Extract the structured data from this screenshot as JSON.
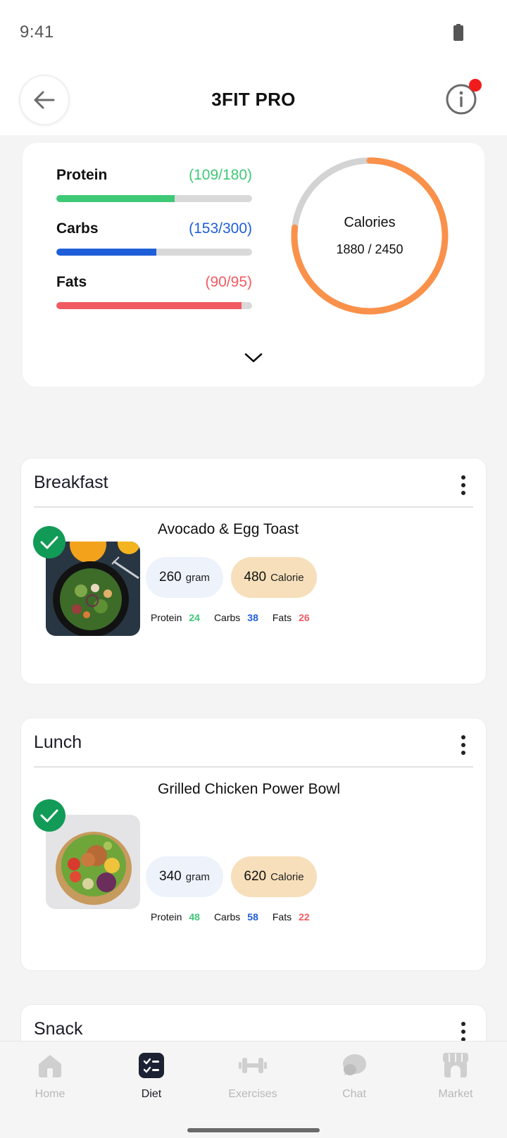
{
  "status_bar": {
    "time": "9:41"
  },
  "header": {
    "title": "3FIT PRO"
  },
  "summary": {
    "macros": [
      {
        "name": "Protein",
        "value": "(109/180)",
        "current": 109,
        "target": 180,
        "color": "#3ec977"
      },
      {
        "name": "Carbs",
        "value": "(153/300)",
        "current": 153,
        "target": 300,
        "color": "#1e5ed8"
      },
      {
        "name": "Fats",
        "value": "(90/95)",
        "current": 90,
        "target": 95,
        "color": "#f25a62"
      }
    ],
    "calories": {
      "label": "Calories",
      "value": "1880 / 2450",
      "current": 1880,
      "target": 2450,
      "color": "#fa914a",
      "track_color": "#d3d3d3"
    }
  },
  "meals": [
    {
      "title": "Breakfast",
      "food": {
        "name": "Avocado & Egg Toast",
        "grams": "260",
        "grams_unit": "gram",
        "calories": "480",
        "calories_unit": "Calorie",
        "protein_label": "Protein",
        "protein": "24",
        "carbs_label": "Carbs",
        "carbs": "38",
        "fats_label": "Fats",
        "fats": "26",
        "checked": true
      }
    },
    {
      "title": "Lunch",
      "food": {
        "name": "Grilled Chicken Power Bowl",
        "grams": "340",
        "grams_unit": "gram",
        "calories": "620",
        "calories_unit": "Calorie",
        "protein_label": "Protein",
        "protein": "48",
        "carbs_label": "Carbs",
        "carbs": "58",
        "fats_label": "Fats",
        "fats": "22",
        "checked": true
      }
    },
    {
      "title": "Snack"
    }
  ],
  "colors": {
    "protein": "#3ec977",
    "carbs": "#1e5ed8",
    "fats": "#f25a62",
    "check": "#129b56"
  },
  "nav": {
    "items": [
      {
        "label": "Home",
        "icon": "home-icon",
        "active": false
      },
      {
        "label": "Diet",
        "icon": "diet-checklist-icon",
        "active": true
      },
      {
        "label": "Exercises",
        "icon": "dumbbell-icon",
        "active": false
      },
      {
        "label": "Chat",
        "icon": "chat-icon",
        "active": false
      },
      {
        "label": "Market",
        "icon": "store-icon",
        "active": false
      }
    ]
  }
}
